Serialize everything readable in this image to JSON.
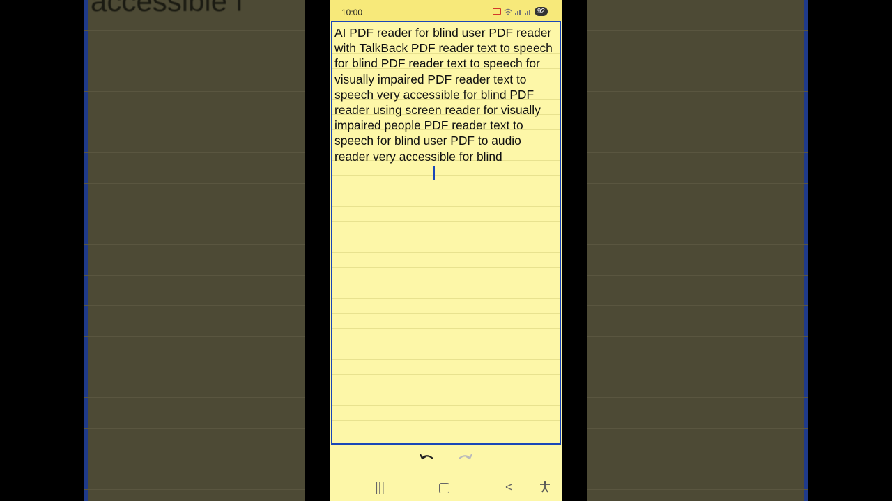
{
  "status_bar": {
    "time": "10:00",
    "battery": "92"
  },
  "note": {
    "text": "AI PDF reader for blind user PDF reader with TalkBack PDF reader text to speech for blind PDF reader text to speech for visually impaired PDF reader text to speech very accessible for blind PDF reader using screen reader for visually impaired people PDF reader text to speech for blind user PDF to audio reader very accessible for blind"
  },
  "background": {
    "visible_text": "accessible f"
  },
  "toolbar": {
    "undo_icon": "undo-icon",
    "redo_icon": "redo-icon"
  },
  "nav": {
    "recent_glyph": "|||",
    "back_glyph": "<",
    "accessibility_glyph": "♿"
  },
  "colors": {
    "note_background": "#fdf7a8",
    "status_bar": "#f7e97a",
    "focus_border": "#1a47b8"
  }
}
